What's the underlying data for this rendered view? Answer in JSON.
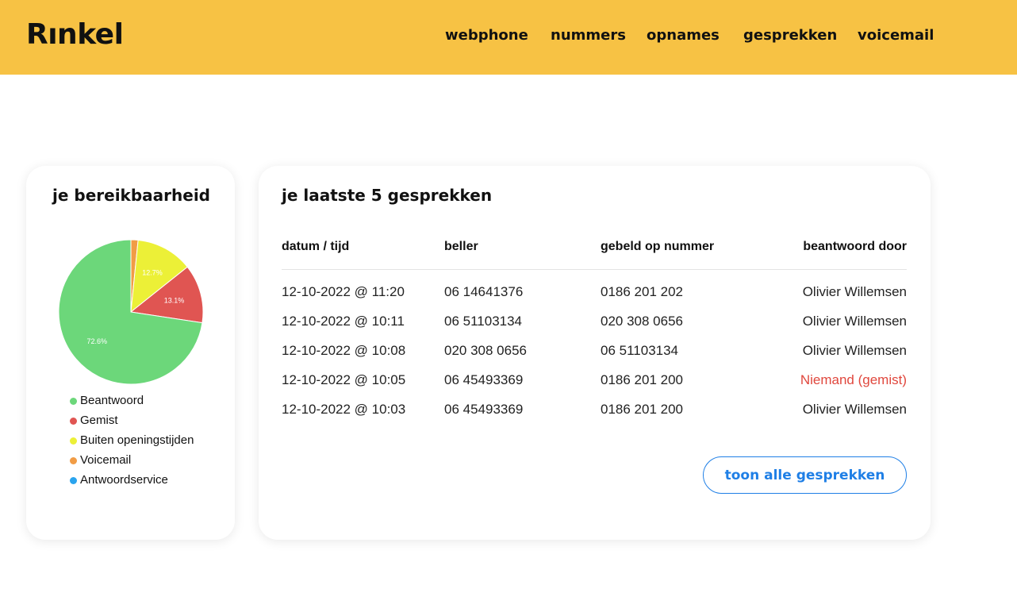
{
  "header": {
    "logo": "Rınkel",
    "nav": [
      {
        "label": "webphone"
      },
      {
        "label": "nummers"
      },
      {
        "label": "opnames"
      },
      {
        "label": "gesprekken"
      },
      {
        "label": "voicemail"
      }
    ]
  },
  "availability": {
    "title": "je bereikbaarheid",
    "chart_data": {
      "type": "pie",
      "slices": [
        {
          "label": "Beantwoord",
          "value": 72.6,
          "color": "#6cd77a",
          "display": "72.6%"
        },
        {
          "label": "Gemist",
          "value": 13.1,
          "color": "#e05552",
          "display": "13.1%"
        },
        {
          "label": "Buiten openingstijden",
          "value": 12.7,
          "color": "#ecf037",
          "display": "12.7%"
        },
        {
          "label": "Voicemail",
          "value": 1.6,
          "color": "#f19c45",
          "display": ""
        },
        {
          "label": "Antwoordservice",
          "value": 0,
          "color": "#2aa4ee",
          "display": ""
        }
      ],
      "legend_position": "bottom"
    }
  },
  "calls": {
    "title": "je laatste 5 gesprekken",
    "columns": [
      "datum / tijd",
      "beller",
      "gebeld op nummer",
      "beantwoord door"
    ],
    "rows": [
      [
        "12-10-2022 @ 11:20",
        "06 14641376",
        "0186 201 202",
        "Olivier Willemsen"
      ],
      [
        "12-10-2022 @ 10:11",
        "06 51103134",
        "020 308 0656",
        "Olivier Willemsen"
      ],
      [
        "12-10-2022 @ 10:08",
        "020 308 0656",
        "06 51103134",
        "Olivier Willemsen"
      ],
      [
        "12-10-2022 @ 10:05",
        "06 45493369",
        "0186 201 200",
        "Niemand (gemist)"
      ],
      [
        "12-10-2022 @ 10:03",
        "06 45493369",
        "0186 201 200",
        "Olivier Willemsen"
      ]
    ],
    "missed_color": "#e0473d",
    "show_all_label": "toon alle gesprekken"
  },
  "colors": {
    "header_bg": "#f7c244",
    "link_blue": "#1f7fe6"
  }
}
